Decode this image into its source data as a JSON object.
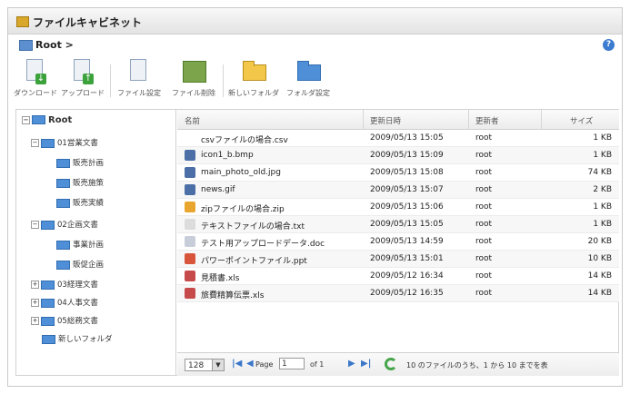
{
  "window": {
    "title": "ファイルキャビネット"
  },
  "breadcrumb": {
    "label": "Root >"
  },
  "toolbar": {
    "download": "ダウンロード",
    "upload": "アップロード",
    "file_settings": "ファイル設定",
    "file_delete": "ファイル削除",
    "new_folder": "新しいフォルダ",
    "folder_settings": "フォルダ設定"
  },
  "tree": {
    "root": "Root",
    "items": [
      {
        "label": "01営業文書"
      },
      {
        "label": "販売計画"
      },
      {
        "label": "販売施策"
      },
      {
        "label": "販売実績"
      },
      {
        "label": "02企画文書"
      },
      {
        "label": "事業計画"
      },
      {
        "label": "販促企画"
      },
      {
        "label": "03経理文書"
      },
      {
        "label": "04人事文書"
      },
      {
        "label": "05総務文書"
      },
      {
        "label": "新しいフォルダ"
      }
    ]
  },
  "grid": {
    "columns": {
      "name": "名前",
      "updated": "更新日時",
      "updater": "更新者",
      "size": "サイズ"
    },
    "rows": [
      {
        "name": "csvファイルの場合.csv",
        "updated": "2009/05/13 15:05",
        "updater": "root",
        "size": "1 KB",
        "icon": "csv-icon"
      },
      {
        "name": "icon1_b.bmp",
        "updated": "2009/05/13 15:09",
        "updater": "root",
        "size": "1 KB",
        "icon": "image-icon"
      },
      {
        "name": "main_photo_old.jpg",
        "updated": "2009/05/13 15:08",
        "updater": "root",
        "size": "74 KB",
        "icon": "image-icon"
      },
      {
        "name": "news.gif",
        "updated": "2009/05/13 15:07",
        "updater": "root",
        "size": "2 KB",
        "icon": "image-icon"
      },
      {
        "name": "zipファイルの場合.zip",
        "updated": "2009/05/13 15:06",
        "updater": "root",
        "size": "1 KB",
        "icon": "zip-icon"
      },
      {
        "name": "テキストファイルの場合.txt",
        "updated": "2009/05/13 15:05",
        "updater": "root",
        "size": "1 KB",
        "icon": "text-icon"
      },
      {
        "name": "テスト用アップロードデータ.doc",
        "updated": "2009/05/13 14:59",
        "updater": "root",
        "size": "20 KB",
        "icon": "doc-icon"
      },
      {
        "name": "パワーポイントファイル.ppt",
        "updated": "2009/05/13 15:01",
        "updater": "root",
        "size": "10 KB",
        "icon": "ppt-icon"
      },
      {
        "name": "見積書.xls",
        "updated": "2009/05/12 16:34",
        "updater": "root",
        "size": "14 KB",
        "icon": "xls-icon"
      },
      {
        "name": "旅費精算伝票.xls",
        "updated": "2009/05/12 16:35",
        "updater": "root",
        "size": "14 KB",
        "icon": "xls-icon"
      }
    ]
  },
  "pager": {
    "page_size": "128",
    "page_label": "Page",
    "page_value": "1",
    "of_label": "of 1",
    "summary": "10 のファイルのうち、1 から 10 までを表"
  },
  "colors": {
    "accent": "#3a77c9",
    "folder": "#4f8fd8"
  }
}
